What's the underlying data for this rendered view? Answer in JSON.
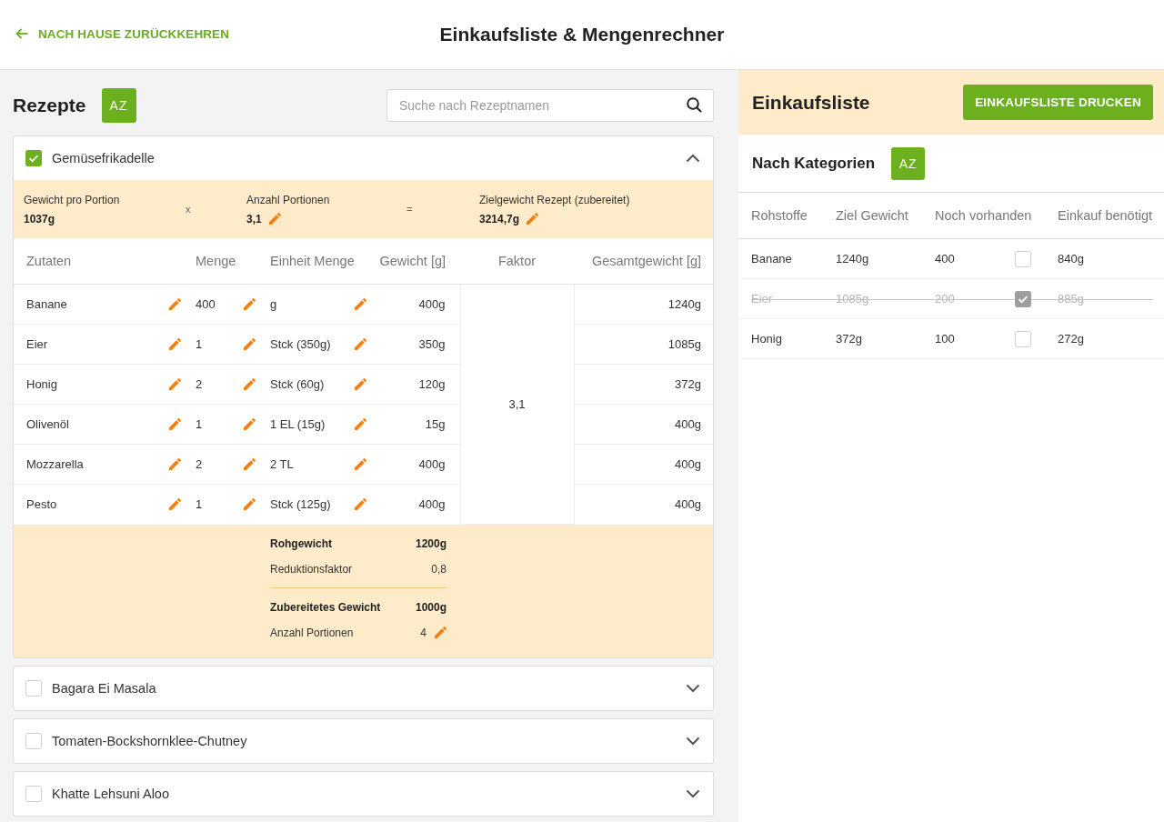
{
  "header": {
    "back_link": "NACH HAUSE ZURÜCKKEHREN",
    "title": "Einkaufsliste & Mengenrechner"
  },
  "recipes_panel": {
    "title": "Rezepte",
    "sort_button": "AZ",
    "search": {
      "placeholder": "Suche nach Rezeptnamen"
    },
    "recipes": [
      {
        "name": "Gemüsefrikadelle",
        "checked": true,
        "expanded": true,
        "calculation": [
          {
            "kind": "field",
            "label": "Gewicht pro Portion",
            "value": "1037g",
            "editable": false
          },
          {
            "kind": "operator",
            "symbol": "x"
          },
          {
            "kind": "field",
            "label": "Anzahl Portionen",
            "value": "3,1",
            "editable": true
          },
          {
            "kind": "operator",
            "symbol": "="
          },
          {
            "kind": "field",
            "label": "Zielgewicht Rezept (zubereitet)",
            "value": "3214,7g",
            "editable": true
          }
        ],
        "ingredients": {
          "columns": [
            "Zutaten",
            "Menge",
            "Einheit Menge",
            "Gewicht [g]",
            "Faktor",
            "Gesamtgewicht [g]"
          ],
          "factor": "3,1",
          "rows": [
            {
              "name": "Banane",
              "amount": "400",
              "unit": "g",
              "weight": "400g",
              "total_weight": "1240g"
            },
            {
              "name": "Eier",
              "amount": "1",
              "unit": "Stck (350g)",
              "weight": "350g",
              "total_weight": "1085g"
            },
            {
              "name": "Honig",
              "amount": "2",
              "unit": "Stck (60g)",
              "weight": "120g",
              "total_weight": "372g"
            },
            {
              "name": "Olivenöl",
              "amount": "1",
              "unit": "1 EL (15g)",
              "weight": "15g",
              "total_weight": "400g"
            },
            {
              "name": "Mozzarella",
              "amount": "2",
              "unit": "2 TL",
              "weight": "400g",
              "total_weight": "400g"
            },
            {
              "name": "Pesto",
              "amount": "1",
              "unit": "Stck (125g)",
              "weight": "400g",
              "total_weight": "400g"
            }
          ]
        },
        "totals": [
          {
            "kind": "total",
            "label": "Rohgewicht",
            "value": "1200g",
            "editable": false
          },
          {
            "kind": "detail",
            "label": "Reduktionsfaktor",
            "value": "0,8",
            "editable": false
          },
          {
            "kind": "divider"
          },
          {
            "kind": "total",
            "label": "Zubereitetes Gewicht",
            "value": "1000g",
            "editable": false
          },
          {
            "kind": "detail",
            "label": "Anzahl Portionen",
            "value": "4",
            "editable": true
          }
        ]
      },
      {
        "name": "Bagara Ei Masala",
        "checked": false,
        "expanded": false
      },
      {
        "name": "Tomaten-Bockshornklee-Chutney",
        "checked": false,
        "expanded": false
      },
      {
        "name": "Khatte Lehsuni Aloo",
        "checked": false,
        "expanded": false
      }
    ]
  },
  "shopping_panel": {
    "title": "Einkaufsliste",
    "print_button": "EINKAUFSLISTE DRUCKEN",
    "section_title": "Nach Kategorien",
    "sort_button": "AZ",
    "table": {
      "columns": [
        "Rohstoffe",
        "Ziel Gewicht",
        "Noch vorhanden",
        "Einkauf benötigt"
      ],
      "rows": [
        {
          "name": "Banane",
          "target_weight": "1240g",
          "available": "400",
          "checked": false,
          "needed": "840g"
        },
        {
          "name": "Eier",
          "target_weight": "1085g",
          "available": "200",
          "checked": true,
          "needed": "885g"
        },
        {
          "name": "Honig",
          "target_weight": "372g",
          "available": "100",
          "checked": false,
          "needed": "272g"
        }
      ]
    }
  }
}
